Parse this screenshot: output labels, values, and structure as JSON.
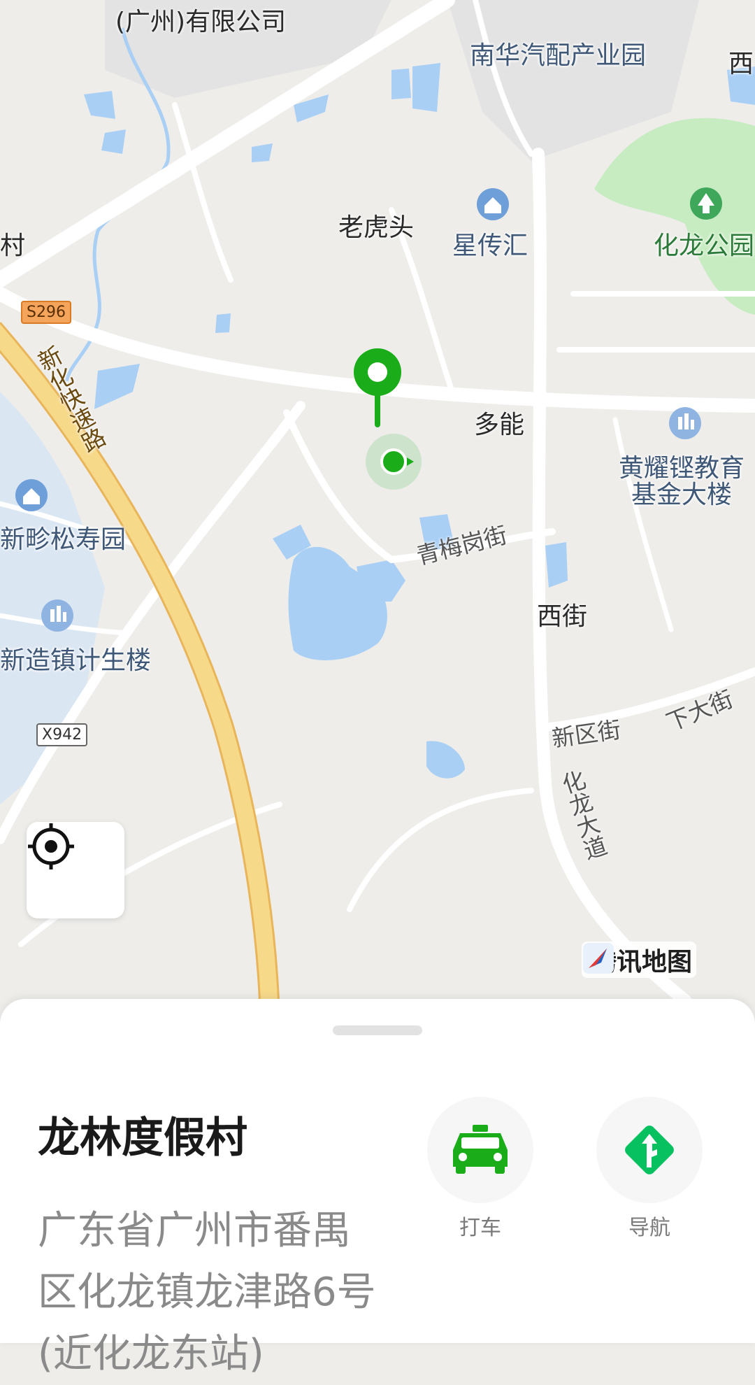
{
  "map": {
    "labels": {
      "company": "(广州)有限公司",
      "nanhua": "南华汽配产业园",
      "xi_edge": "西",
      "laohutou": "老虎头",
      "xingchuanhui": "星传汇",
      "hualong_park": "化龙公园",
      "cun": "村",
      "duoneng": "多能",
      "huangyao": "黄耀铿教育",
      "huangyao2": "基金大楼",
      "xinpang": "新畛松寿园",
      "qingmei": "青梅岗街",
      "xijie": "西街",
      "jisheng": "新造镇计生楼",
      "xinqu": "新区街",
      "xiadajie": "下大街",
      "hualong_ave": "化龙大道",
      "xinhua_expressway": "新化快速路"
    },
    "shields": {
      "s296": "S296",
      "x942": "X942"
    },
    "logo_text": "腾讯地图",
    "icons": {
      "locate": "locate-crosshair-icon",
      "pin": "location-pin-icon",
      "current": "current-location-icon",
      "logo": "tencent-map-logo-icon",
      "building": "building-icon",
      "tree": "tree-icon",
      "house": "house-icon"
    }
  },
  "sheet": {
    "place_name": "龙林度假村",
    "address": "广东省广州市番禺区化龙镇龙津路6号(近化龙东站)",
    "actions": [
      {
        "label": "打车",
        "icon": "taxi-icon"
      },
      {
        "label": "导航",
        "icon": "navigation-icon"
      }
    ]
  },
  "colors": {
    "accent": "#1aad19",
    "nav_green": "#07c160",
    "water": "#a9cff5",
    "park": "#c8ecc1",
    "highway": "#f7d98a"
  }
}
